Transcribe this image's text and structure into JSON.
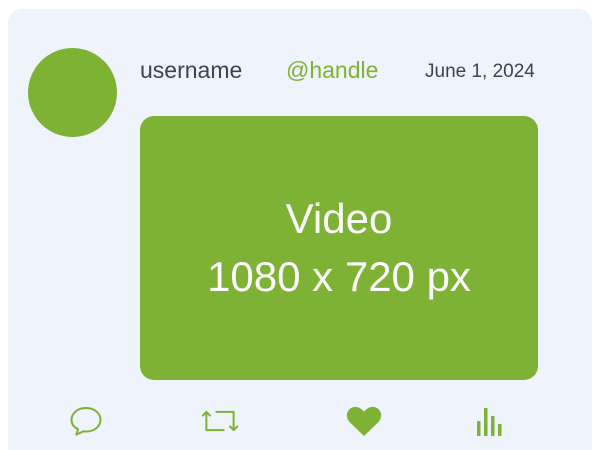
{
  "post": {
    "username": "username",
    "handle": "@handle",
    "date": "June 1, 2024",
    "media": {
      "line1": "Video",
      "line2": "1080 x 720 px"
    }
  },
  "actions": [
    {
      "name": "reply",
      "icon": "speech-bubble-icon"
    },
    {
      "name": "repost",
      "icon": "repost-arrows-icon"
    },
    {
      "name": "like",
      "icon": "heart-icon"
    },
    {
      "name": "stats",
      "icon": "bar-chart-icon"
    }
  ],
  "colors": {
    "accent": "#7db234",
    "card_background": "#eff3fb",
    "text": "#3b4451"
  }
}
